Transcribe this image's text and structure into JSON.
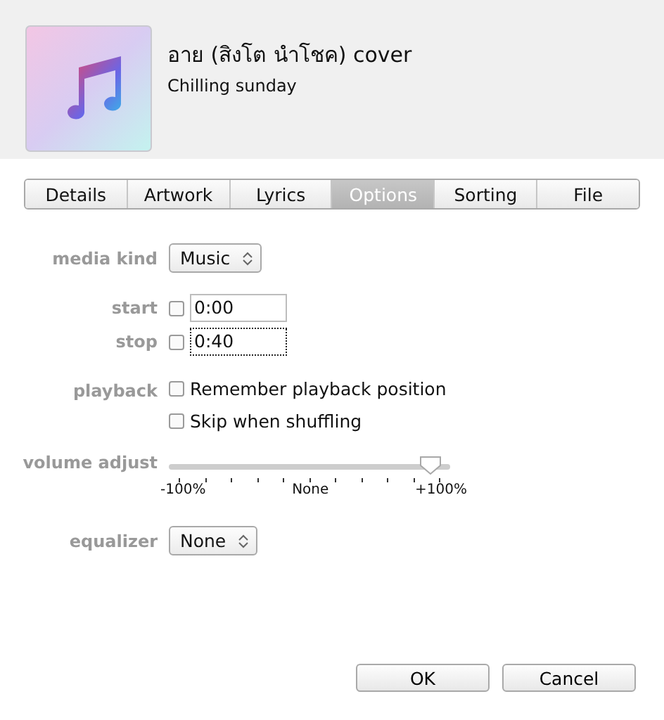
{
  "header": {
    "title": "อาย (สิงโต นำโชค) cover",
    "subtitle": "Chilling sunday"
  },
  "tabs": [
    {
      "label": "Details",
      "selected": false
    },
    {
      "label": "Artwork",
      "selected": false
    },
    {
      "label": "Lyrics",
      "selected": false
    },
    {
      "label": "Options",
      "selected": true
    },
    {
      "label": "Sorting",
      "selected": false
    },
    {
      "label": "File",
      "selected": false
    }
  ],
  "media_kind": {
    "label": "media kind",
    "value": "Music"
  },
  "start": {
    "label": "start",
    "checked": false,
    "value": "0:00",
    "focused": false
  },
  "stop": {
    "label": "stop",
    "checked": false,
    "value": "0:40",
    "focused": true
  },
  "playback": {
    "label": "playback",
    "options": [
      {
        "label": "Remember playback position",
        "checked": false
      },
      {
        "label": "Skip when shuffling",
        "checked": false
      }
    ]
  },
  "volume_adjust": {
    "label": "volume adjust",
    "level": 0.93,
    "min_label": "-100%",
    "mid_label": "None",
    "max_label": "+100%"
  },
  "equalizer": {
    "label": "equalizer",
    "value": "None"
  },
  "buttons": [
    "OK",
    "Cancel"
  ]
}
